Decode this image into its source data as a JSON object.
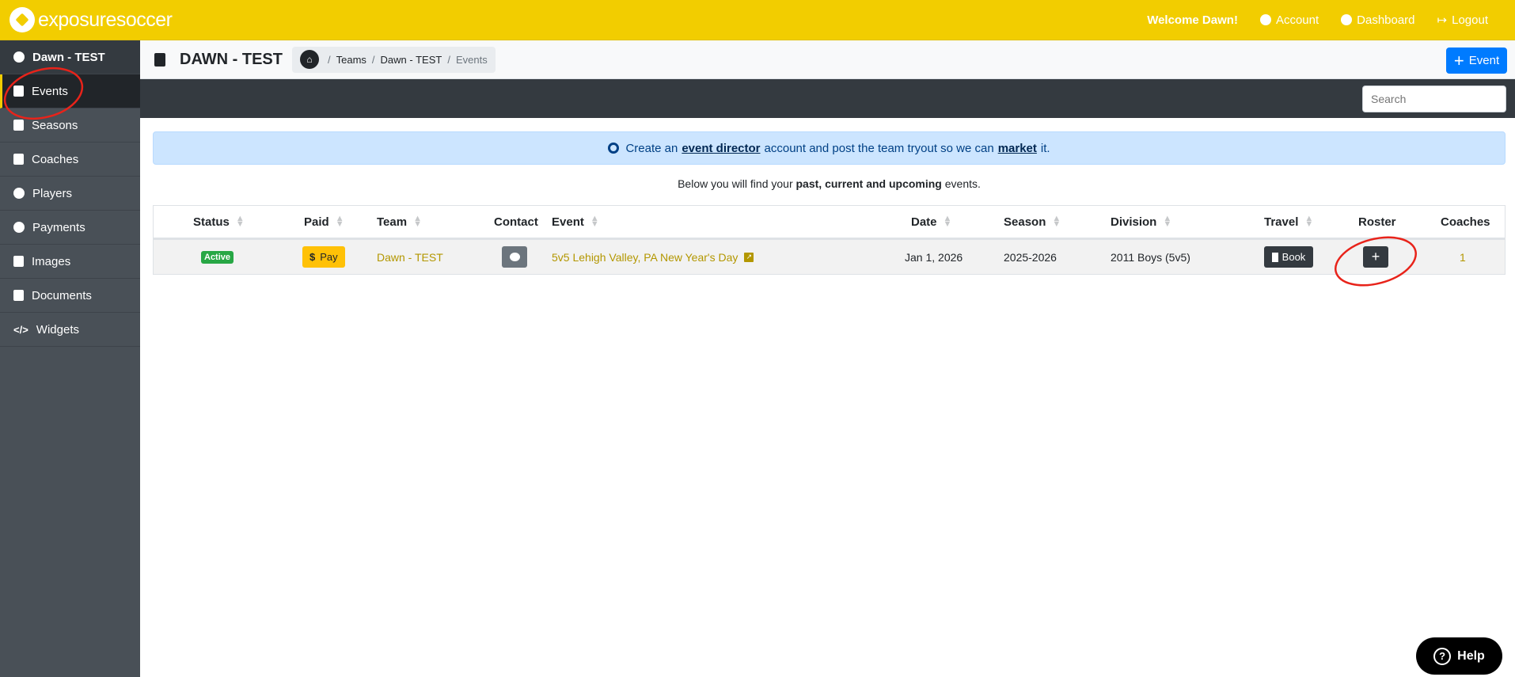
{
  "brand": {
    "name_bold": "exposure",
    "name_light": "soccer"
  },
  "topnav": {
    "welcome": "Welcome Dawn!",
    "account": "Account",
    "dashboard": "Dashboard",
    "logout": "Logout"
  },
  "sidebar": {
    "back_label": "Dawn - TEST",
    "items": [
      {
        "label": "Events",
        "icon": "calendar-icon",
        "active": true
      },
      {
        "label": "Seasons",
        "icon": "calendar-alt-icon"
      },
      {
        "label": "Coaches",
        "icon": "id-badge-icon"
      },
      {
        "label": "Players",
        "icon": "user-icon"
      },
      {
        "label": "Payments",
        "icon": "search-dollar-icon"
      },
      {
        "label": "Images",
        "icon": "images-icon"
      },
      {
        "label": "Documents",
        "icon": "file-icon"
      },
      {
        "label": "Widgets",
        "icon": "code-icon"
      }
    ]
  },
  "header": {
    "title": "DAWN - TEST",
    "breadcrumb": [
      "Teams",
      "Dawn - TEST",
      "Events"
    ],
    "add_event_label": "Event"
  },
  "search": {
    "placeholder": "Search"
  },
  "alert": {
    "pre": "Create an",
    "link1": "event director",
    "mid": "account and post the team tryout so we can",
    "link2": "market",
    "post": "it."
  },
  "intro": {
    "pre": "Below you will find your",
    "bold": "past, current and upcoming",
    "post": "events."
  },
  "table": {
    "columns": [
      "Status",
      "Paid",
      "Team",
      "Contact",
      "Event",
      "Date",
      "Season",
      "Division",
      "Travel",
      "Roster",
      "Coaches"
    ],
    "rows": [
      {
        "status": "Active",
        "paid": "Pay",
        "team": "Dawn - TEST",
        "event": "5v5 Lehigh Valley, PA New Year's Day",
        "date": "Jan 1, 2026",
        "season": "2025-2026",
        "division": "2011 Boys (5v5)",
        "travel": "Book",
        "roster": "+",
        "coaches": "1"
      }
    ]
  },
  "help": {
    "label": "Help"
  },
  "colors": {
    "brand": "#f2cd00",
    "primary": "#007bff",
    "success": "#28a745",
    "warning": "#ffc107",
    "dark": "#343a40",
    "sidebar": "#495057"
  }
}
